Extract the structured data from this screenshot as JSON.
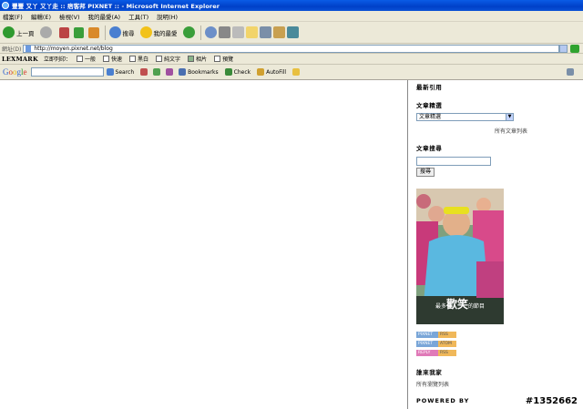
{
  "window": {
    "title": "豐豐 又丫 又丫走 :: 痞客邦 PIXNET :: - Microsoft Internet Explorer"
  },
  "menu": [
    "檔案(F)",
    "編輯(E)",
    "檢視(V)",
    "我的最愛(A)",
    "工具(T)",
    "說明(H)"
  ],
  "toolbar": {
    "back": "上一頁",
    "search": "搜尋",
    "favorites": "我的最愛"
  },
  "address": {
    "label": "網址(D)",
    "url": "http://moyen.pixnet.net/blog"
  },
  "lexmark": {
    "brand": "LEXMARK",
    "print_now": "立即列印：",
    "items": [
      "一般",
      "快速",
      "黑白",
      "純文字",
      "相片",
      "預覽"
    ]
  },
  "google": {
    "logo": "Google",
    "search": "Search",
    "bookmarks": "Bookmarks",
    "check": "Check",
    "autofill": "AutoFill"
  },
  "sidebar": {
    "recent_quotes": "最新引用",
    "article_select_title": "文章精選",
    "article_select_value": "文章精選",
    "all_articles": "所有文章列表",
    "article_search_title": "文章搜尋",
    "search_button": "搜尋",
    "photo_caption_a": "最多",
    "photo_caption_b": "歡笑",
    "photo_caption_c": "的節目",
    "badges": [
      {
        "left": "PIXNET",
        "right": "RSS",
        "color": "#7aa6d8"
      },
      {
        "left": "PIXNET",
        "right": "ATOM",
        "color": "#7aa6d8"
      },
      {
        "left": "REPLY",
        "right": "RSS",
        "color": "#e07ab8"
      }
    ],
    "visitors_title": "誰來我家",
    "visitors_link": "所有瀏覽列表",
    "powered_by": "POWERED BY"
  },
  "watermark": "#1352662"
}
